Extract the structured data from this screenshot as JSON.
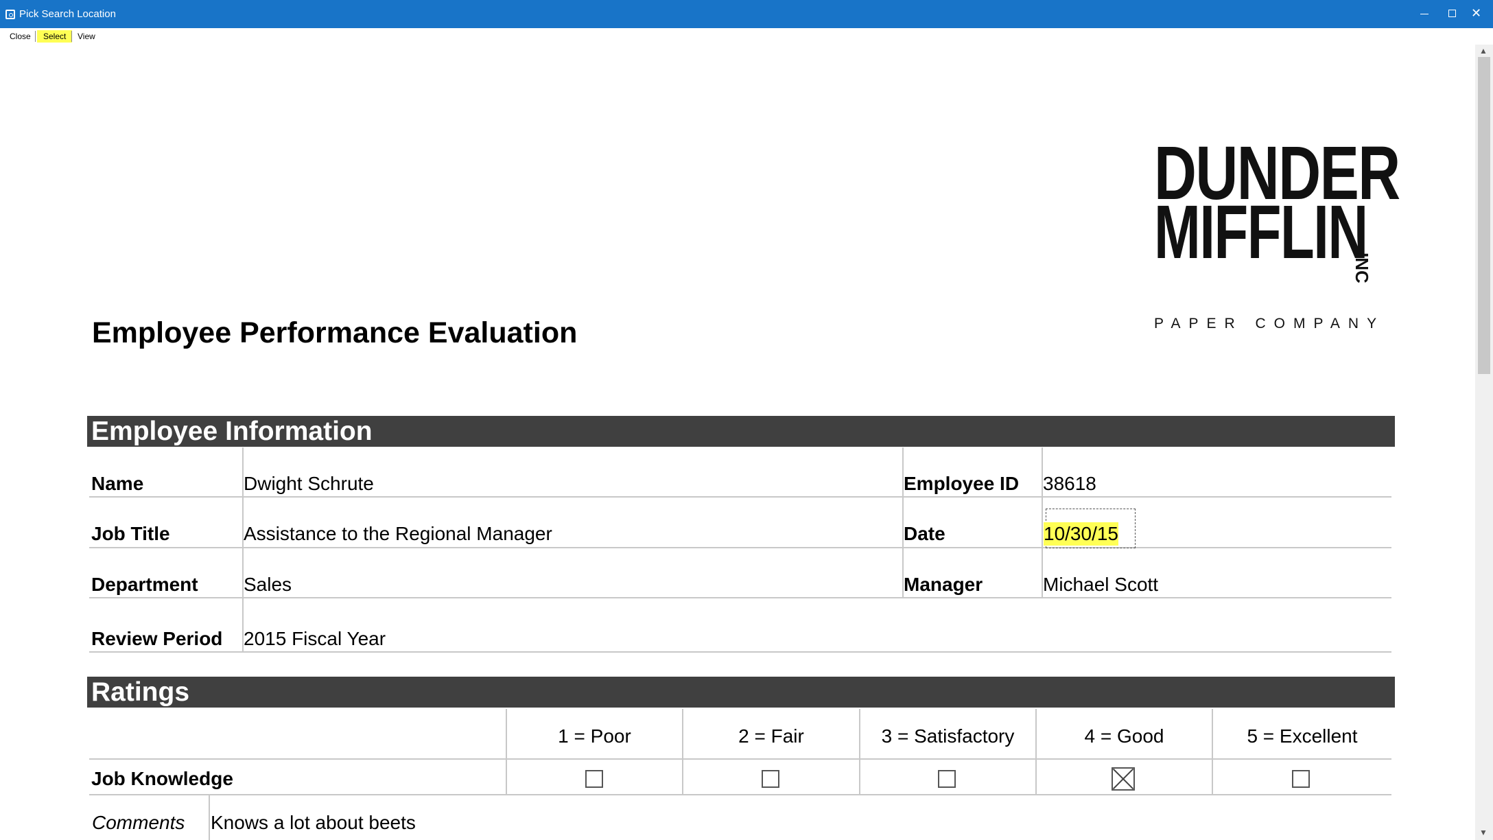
{
  "window": {
    "title": "Pick Search Location",
    "title_bar_color": "#1874c8",
    "controls": [
      "minimize-icon",
      "maximize-icon",
      "close-icon"
    ]
  },
  "toolbar": {
    "close_label": "Close",
    "select_label": "Select",
    "view_label": "View",
    "highlight_color": "#ffff55"
  },
  "logo": {
    "line1": "DUNDER",
    "line2": "MIFFLIN",
    "inc": "INC",
    "subtitle": "PAPER COMPANY"
  },
  "document": {
    "title": "Employee Performance Evaluation",
    "section_color": "#404040",
    "employee_info": {
      "header": "Employee Information",
      "name_label": "Name",
      "name_value": "Dwight Schrute",
      "employee_id_label": "Employee ID",
      "employee_id_value": "38618",
      "job_title_label": "Job Title",
      "job_title_value": "Assistance to the Regional Manager",
      "date_label": "Date",
      "date_value": "10/30/15",
      "department_label": "Department",
      "department_value": "Sales",
      "manager_label": "Manager",
      "manager_value": "Michael Scott",
      "review_period_label": "Review Period",
      "review_period_value": "2015 Fiscal Year"
    },
    "ratings": {
      "header": "Ratings",
      "scale": [
        "1 = Poor",
        "2 = Fair",
        "3 = Satisfactory",
        "4 = Good",
        "5 = Excellent"
      ],
      "rows": [
        {
          "label": "Job Knowledge",
          "selected": 4,
          "comments_label": "Comments",
          "comments": "Knows a lot about beets"
        }
      ]
    }
  }
}
